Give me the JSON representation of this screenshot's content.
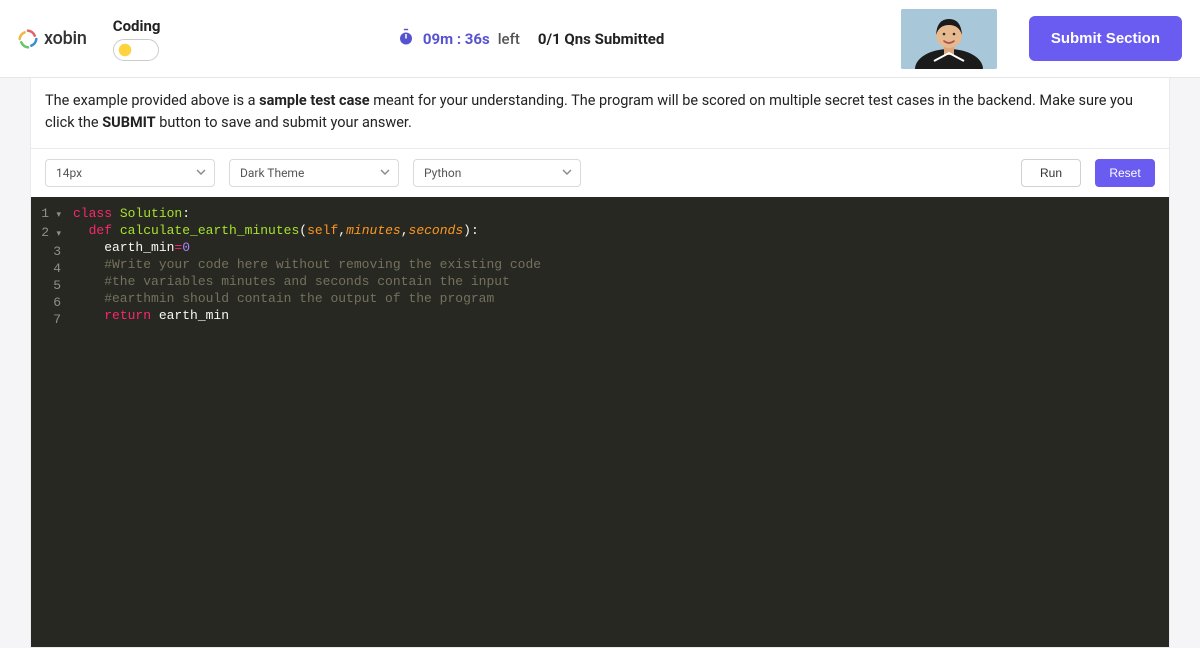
{
  "header": {
    "logo_text": "xobin",
    "title": "Coding",
    "timer": "09m : 36s",
    "timer_left_label": "left",
    "qns_status": "0/1 Qns Submitted",
    "submit_label": "Submit Section"
  },
  "instructions": {
    "pre": "The example provided above is a ",
    "bold1": "sample test case",
    "mid": " meant for your understanding. The program will be scored on multiple secret test cases in the backend. Make sure you click the ",
    "bold2": "SUBMIT",
    "post": " button to save and submit your answer."
  },
  "toolbar": {
    "font_size": "14px",
    "theme": "Dark Theme",
    "language": "Python",
    "run_label": "Run",
    "reset_label": "Reset"
  },
  "editor": {
    "gutter": [
      "1",
      "2",
      "3",
      "4",
      "5",
      "6",
      "7"
    ],
    "foldable_lines": [
      0,
      1
    ],
    "lines": [
      [
        {
          "t": "class ",
          "c": "kw"
        },
        {
          "t": "Solution",
          "c": "cls"
        },
        {
          "t": ":",
          "c": "punct"
        }
      ],
      [
        {
          "t": "  ",
          "c": ""
        },
        {
          "t": "def ",
          "c": "kw"
        },
        {
          "t": "calculate_earth_minutes",
          "c": "cls"
        },
        {
          "t": "(",
          "c": "punct"
        },
        {
          "t": "self",
          "c": "self"
        },
        {
          "t": ",",
          "c": "punct"
        },
        {
          "t": "minutes",
          "c": "param"
        },
        {
          "t": ",",
          "c": "punct"
        },
        {
          "t": "seconds",
          "c": "param"
        },
        {
          "t": ")",
          "c": "punct"
        },
        {
          "t": ":",
          "c": "punct"
        }
      ],
      [
        {
          "t": "    earth_min",
          "c": "ident"
        },
        {
          "t": "=",
          "c": "kw"
        },
        {
          "t": "0",
          "c": "num"
        }
      ],
      [
        {
          "t": "    #Write your code here without removing the existing code",
          "c": "comment"
        }
      ],
      [
        {
          "t": "    #the variables minutes and seconds contain the input",
          "c": "comment"
        }
      ],
      [
        {
          "t": "    #earthmin should contain the output of the program",
          "c": "comment"
        }
      ],
      [
        {
          "t": "    ",
          "c": ""
        },
        {
          "t": "return ",
          "c": "kw"
        },
        {
          "t": "earth_min",
          "c": "ident"
        }
      ]
    ]
  }
}
